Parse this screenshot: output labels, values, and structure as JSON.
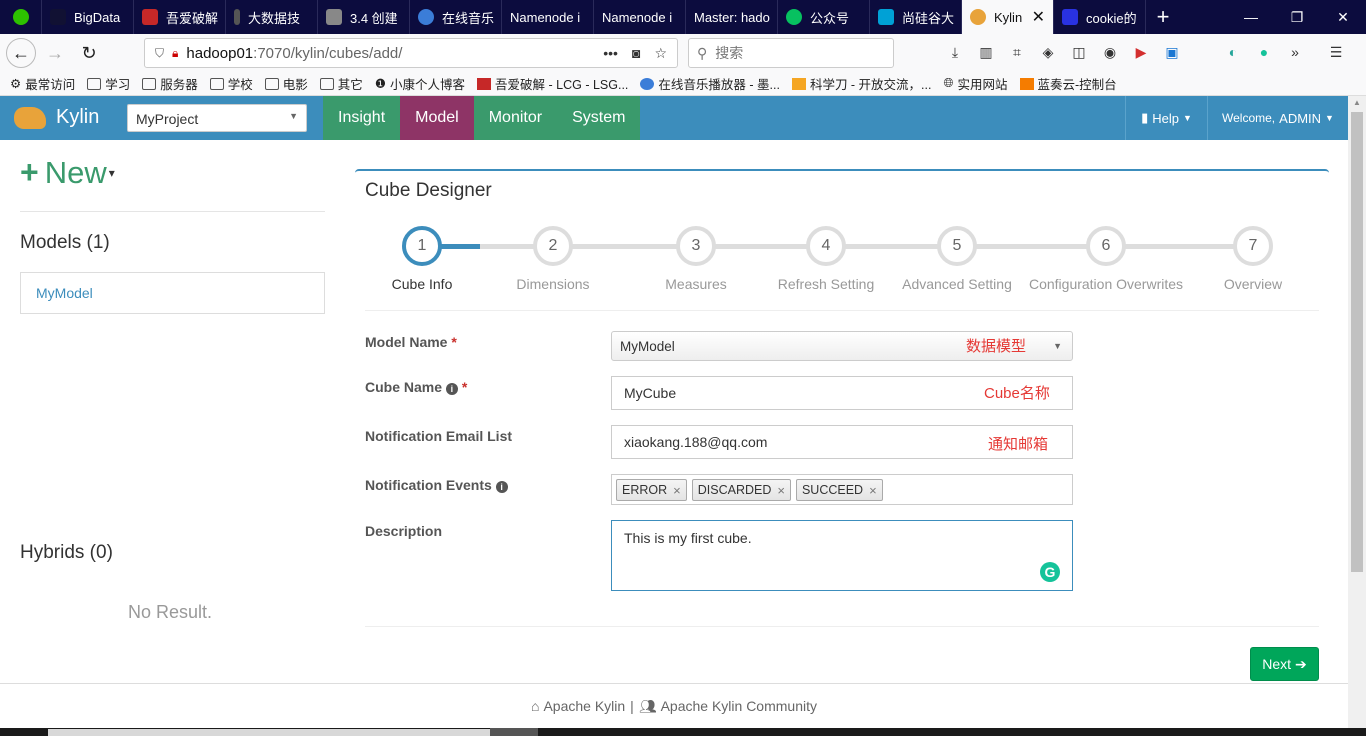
{
  "browser": {
    "tabs": [
      {
        "label": "",
        "icon": "wechat-icon",
        "color": "#2dc100"
      },
      {
        "label": "BigData",
        "icon": "bigdata-icon",
        "color": "#111133"
      },
      {
        "label": "吾爱破解",
        "icon": "52pojie-icon",
        "color": "#c62828"
      },
      {
        "label": "大数据技",
        "icon": "pen-icon",
        "color": "#555555"
      },
      {
        "label": "3.4 创建",
        "icon": "book-icon",
        "color": "#888888"
      },
      {
        "label": "在线音乐",
        "icon": "globe-icon",
        "color": "#3b7dd8"
      },
      {
        "label": "Namenode i",
        "icon": "page-icon",
        "color": "#0c0c3e"
      },
      {
        "label": "Namenode i",
        "icon": "page-icon",
        "color": "#0c0c3e"
      },
      {
        "label": "Master: hado",
        "icon": "page-icon",
        "color": "#0c0c3e"
      },
      {
        "label": "公众号",
        "icon": "wechat-mp-icon",
        "color": "#07c160"
      },
      {
        "label": "尚硅谷大",
        "icon": "bilibili-icon",
        "color": "#00a1d6"
      },
      {
        "label": "Kylin",
        "icon": "kylin-icon",
        "color": "#e8a33a",
        "active": true
      },
      {
        "label": "cookie的",
        "icon": "baidu-icon",
        "color": "#2932e1"
      }
    ],
    "url_host": "hadoop01",
    "url_path": ":7070/kylin/cubes/add/",
    "search_placeholder": "搜索",
    "url_more": "•••",
    "bookmarks": [
      {
        "label": "最常访问",
        "icon": "gear-icon"
      },
      {
        "label": "学习",
        "icon": "folder-icon"
      },
      {
        "label": "服务器",
        "icon": "folder-icon"
      },
      {
        "label": "学校",
        "icon": "folder-icon"
      },
      {
        "label": "电影",
        "icon": "folder-icon"
      },
      {
        "label": "其它",
        "icon": "folder-icon"
      },
      {
        "label": "小康个人博客",
        "icon": "blog-icon"
      },
      {
        "label": "吾爱破解 - LCG - LSG...",
        "icon": "52pojie-icon"
      },
      {
        "label": "在线音乐播放器 - 墨...",
        "icon": "globe-icon"
      },
      {
        "label": "科学刀 - 开放交流，...",
        "icon": "knife-icon"
      },
      {
        "label": "实用网站",
        "icon": "globe-icon"
      },
      {
        "label": "蓝奏云-控制台",
        "icon": "lanzou-icon"
      }
    ]
  },
  "kylin": {
    "brand": "Kylin",
    "project": "MyProject",
    "nav": [
      {
        "label": "Insight",
        "active": false
      },
      {
        "label": "Model",
        "active": true
      },
      {
        "label": "Monitor",
        "active": false
      },
      {
        "label": "System",
        "active": false
      }
    ],
    "help": "Help",
    "welcome": "Welcome,",
    "user": "ADMIN",
    "colors": {
      "header": "#3c8dbc",
      "nav": "#3a9a6c",
      "nav_active": "#8e3466",
      "next": "#00a65a"
    }
  },
  "sidebar": {
    "new_label": "New",
    "models_title": "Models (1)",
    "models": [
      "MyModel"
    ],
    "hybrids_title": "Hybrids (0)",
    "no_result": "No Result."
  },
  "designer": {
    "title": "Cube Designer",
    "steps": [
      {
        "num": "1",
        "label": "Cube Info"
      },
      {
        "num": "2",
        "label": "Dimensions"
      },
      {
        "num": "3",
        "label": "Measures"
      },
      {
        "num": "4",
        "label": "Refresh Setting"
      },
      {
        "num": "5",
        "label": "Advanced Setting"
      },
      {
        "num": "6",
        "label": "Configuration Overwrites"
      },
      {
        "num": "7",
        "label": "Overview"
      }
    ],
    "active_step": 1,
    "form": {
      "model_name_label": "Model Name",
      "model_name_value": "MyModel",
      "model_anno": "数据模型",
      "cube_name_label": "Cube Name",
      "cube_name_value": "MyCube",
      "cube_anno": "Cube名称",
      "email_label": "Notification Email List",
      "email_value": "xiaokang.188@qq.com",
      "email_anno": "通知邮箱",
      "events_label": "Notification Events",
      "events": [
        "ERROR",
        "DISCARDED",
        "SUCCEED"
      ],
      "description_label": "Description",
      "description_value": "This is my first cube.",
      "required_mark": "*"
    },
    "next_label": "Next"
  },
  "footer": {
    "link1": "Apache Kylin",
    "separator": "|",
    "link2": "Apache Kylin Community"
  }
}
